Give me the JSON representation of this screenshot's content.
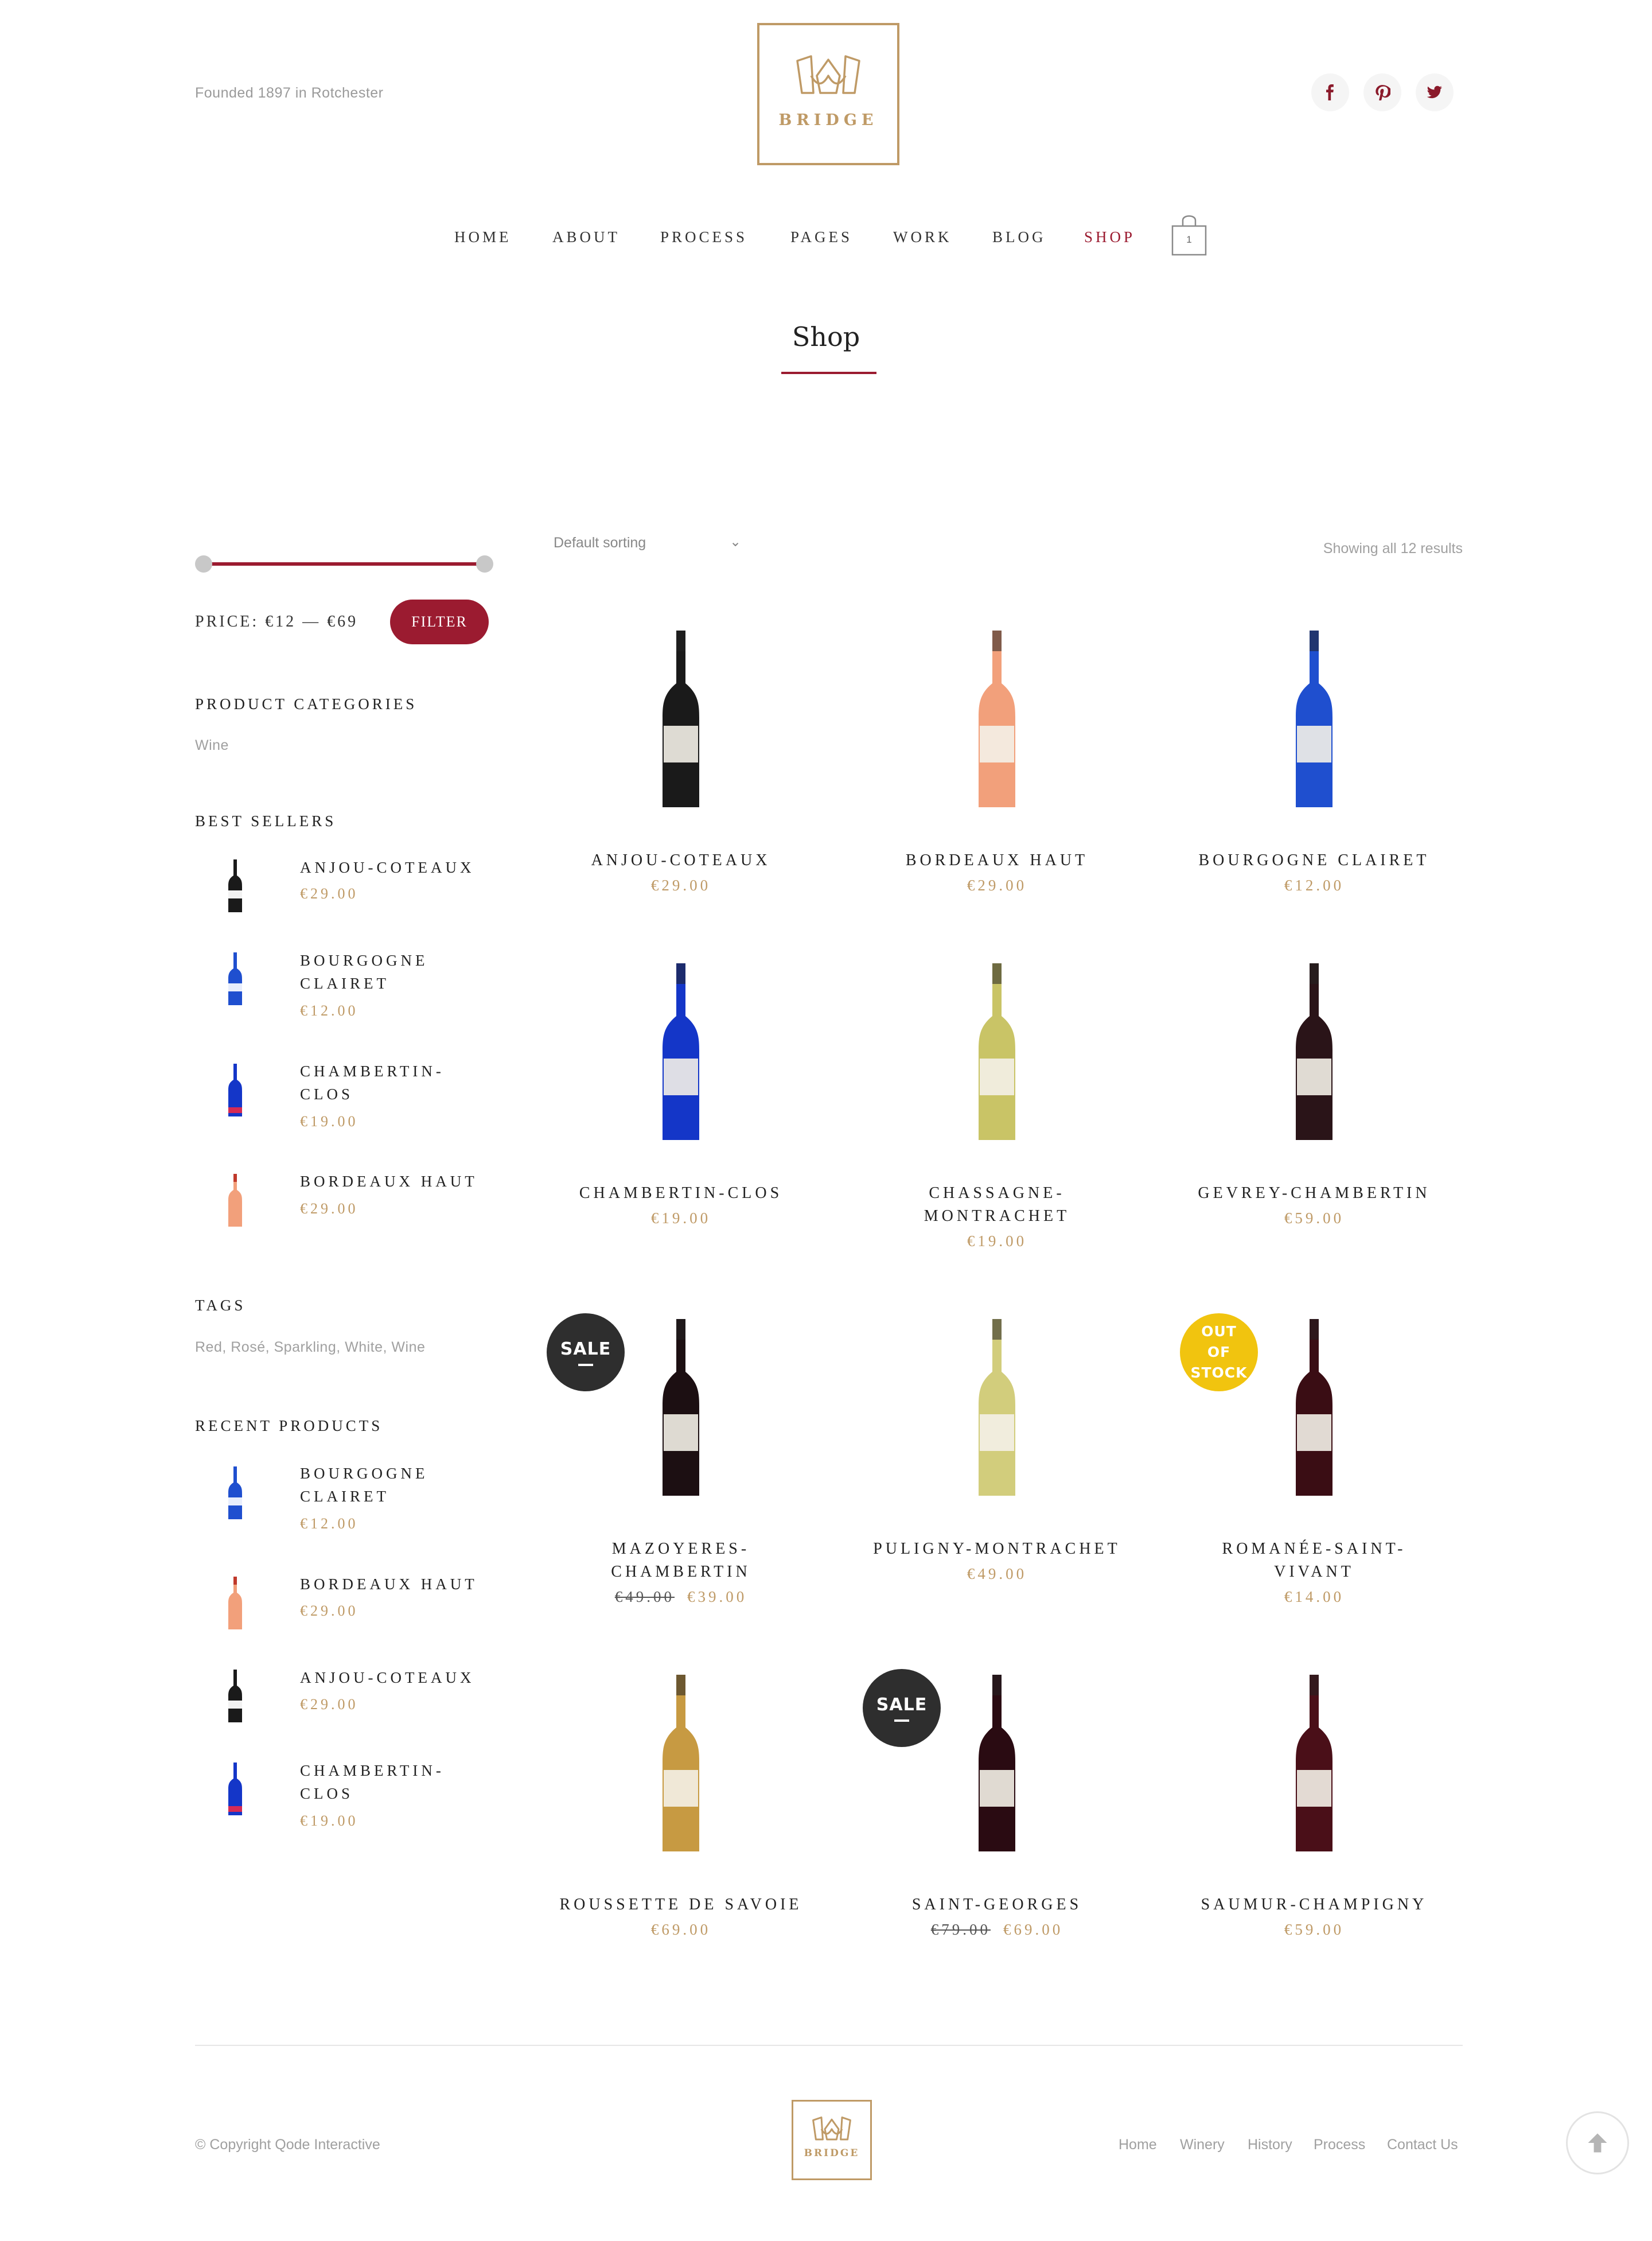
{
  "header": {
    "tagline": "Founded 1897 in Rotchester",
    "logo_text": "BRIDGE",
    "social": [
      "facebook-icon",
      "pinterest-icon",
      "twitter-icon"
    ]
  },
  "nav": {
    "items": [
      "HOME",
      "ABOUT",
      "PROCESS",
      "PAGES",
      "WORK",
      "BLOG",
      "SHOP"
    ],
    "active": "SHOP",
    "cart_count": "1"
  },
  "page_title": "Shop",
  "sidebar": {
    "price_label": "PRICE: €12 — €69",
    "filter_label": "FILTER",
    "categories_heading": "PRODUCT CATEGORIES",
    "categories": [
      "Wine"
    ],
    "best_sellers_heading": "BEST SELLERS",
    "best_sellers": [
      {
        "line1": "ANJOU-COTEAUX",
        "line2": "",
        "price": "€29.00"
      },
      {
        "line1": "BOURGOGNE",
        "line2": "CLAIRET",
        "price": "€12.00"
      },
      {
        "line1": "CHAMBERTIN-",
        "line2": "CLOS",
        "price": "€19.00"
      },
      {
        "line1": "BORDEAUX HAUT",
        "line2": "",
        "price": "€29.00"
      }
    ],
    "tags_heading": "TAGS",
    "tags": "Red, Rosé, Sparkling, White, Wine",
    "recent_heading": "RECENT PRODUCTS",
    "recent": [
      {
        "line1": "BOURGOGNE",
        "line2": "CLAIRET",
        "price": "€12.00"
      },
      {
        "line1": "BORDEAUX HAUT",
        "line2": "",
        "price": "€29.00"
      },
      {
        "line1": "ANJOU-COTEAUX",
        "line2": "",
        "price": "€29.00"
      },
      {
        "line1": "CHAMBERTIN-",
        "line2": "CLOS",
        "price": "€19.00"
      }
    ]
  },
  "shop": {
    "sorting": "Default sorting",
    "results": "Showing all 12 results",
    "products": [
      {
        "line1": "ANJOU-COTEAUX",
        "line2": "",
        "old_price": "",
        "price": "€29.00",
        "badge": "",
        "color": "#1a1a1a"
      },
      {
        "line1": "BORDEAUX HAUT",
        "line2": "",
        "old_price": "",
        "price": "€29.00",
        "badge": "",
        "color": "#f2a07b"
      },
      {
        "line1": "BOURGOGNE CLAIRET",
        "line2": "",
        "old_price": "",
        "price": "€12.00",
        "badge": "",
        "color": "#1f4fcf"
      },
      {
        "line1": "CHAMBERTIN-CLOS",
        "line2": "",
        "old_price": "",
        "price": "€19.00",
        "badge": "",
        "color": "#1436c8"
      },
      {
        "line1": "CHASSAGNE-",
        "line2": "MONTRACHET",
        "old_price": "",
        "price": "€19.00",
        "badge": "",
        "color": "#c9c466"
      },
      {
        "line1": "GEVREY-CHAMBERTIN",
        "line2": "",
        "old_price": "",
        "price": "€59.00",
        "badge": "",
        "color": "#2a1418"
      },
      {
        "line1": "MAZOYERES-",
        "line2": "CHAMBERTIN",
        "old_price": "€49.00",
        "price": "€39.00",
        "badge": "SALE",
        "color": "#1c0f12"
      },
      {
        "line1": "PULIGNY-MONTRACHET",
        "line2": "",
        "old_price": "",
        "price": "€49.00",
        "badge": "",
        "color": "#d2cd7c"
      },
      {
        "line1": "ROMANÉE-SAINT-",
        "line2": "VIVANT",
        "old_price": "",
        "price": "€14.00",
        "badge": "OUT OF STOCK",
        "color": "#3a0d14"
      },
      {
        "line1": "ROUSSETTE DE SAVOIE",
        "line2": "",
        "old_price": "",
        "price": "€69.00",
        "badge": "",
        "color": "#c79a42"
      },
      {
        "line1": "SAINT-GEORGES",
        "line2": "",
        "old_price": "€79.00",
        "price": "€69.00",
        "badge": "SALE",
        "color": "#2a0b12"
      },
      {
        "line1": "SAUMUR-CHAMPIGNY",
        "line2": "",
        "old_price": "",
        "price": "€59.00",
        "badge": "",
        "color": "#4a0f18"
      }
    ]
  },
  "footer": {
    "copyright": "© Copyright Qode Interactive",
    "logo_text": "BRIDGE",
    "links": [
      "Home",
      "Winery",
      "History",
      "Process",
      "Contact Us"
    ]
  },
  "colors": {
    "accent": "#9b1b30",
    "gold": "#bf9a66",
    "badge_sale": "#2e2e2e",
    "badge_out_of_stock": "#f1c40f"
  }
}
